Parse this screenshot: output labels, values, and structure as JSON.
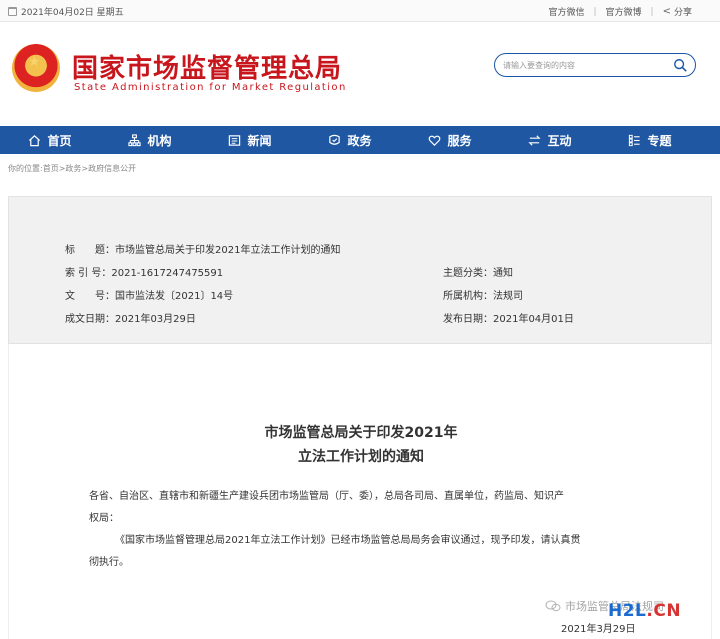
{
  "topbar": {
    "date": "2021年04月02日 星期五",
    "links": [
      "官方微信",
      "官方微博"
    ],
    "share": "分享"
  },
  "header": {
    "title_cn": "国家市场监督管理总局",
    "title_en": "State Administration for Market Regulation",
    "search_placeholder": "请输入要查询的内容"
  },
  "nav": {
    "items": [
      {
        "label": "首页",
        "icon": "home-icon"
      },
      {
        "label": "机构",
        "icon": "org-icon"
      },
      {
        "label": "新闻",
        "icon": "news-icon"
      },
      {
        "label": "政务",
        "icon": "government-icon"
      },
      {
        "label": "服务",
        "icon": "heart-icon"
      },
      {
        "label": "互动",
        "icon": "exchange-icon"
      },
      {
        "label": "专题",
        "icon": "topics-icon"
      }
    ]
  },
  "breadcrumb": "你的位置:首页>政务>政府信息公开",
  "meta": {
    "title_label": "标　　题：",
    "title_value": "市场监管总局关于印发2021年立法工作计划的通知",
    "index_label": "索 引 号：",
    "index_value": "2021-1617247475591",
    "category_label": "主题分类：",
    "category_value": "通知",
    "doc_label": "文　　号：",
    "doc_value": "国市监法发〔2021〕14号",
    "org_label": "所属机构：",
    "org_value": "法规司",
    "written_label": "成文日期：",
    "written_value": "2021年03月29日",
    "published_label": "发布日期：",
    "published_value": "2021年04月01日"
  },
  "document": {
    "title_line1": "市场监管总局关于印发2021年",
    "title_line2": "立法工作计划的通知",
    "addressee_line1": "各省、自治区、直辖市和新疆生产建设兵团市场监管局（厅、委），总局各司局、直属单位，药监局、知识产",
    "addressee_line2": "权局：",
    "body_line1": "《国家市场监督管理总局2021年立法工作计划》已经市场监管总局局务会审议通过，现予印发，请认真贯",
    "body_line2": "彻执行。",
    "signature_overlay": "市场监管总局法规司",
    "date": "2021年3月29日"
  },
  "watermark": {
    "part1": "H2L",
    "part2": ".CN"
  }
}
